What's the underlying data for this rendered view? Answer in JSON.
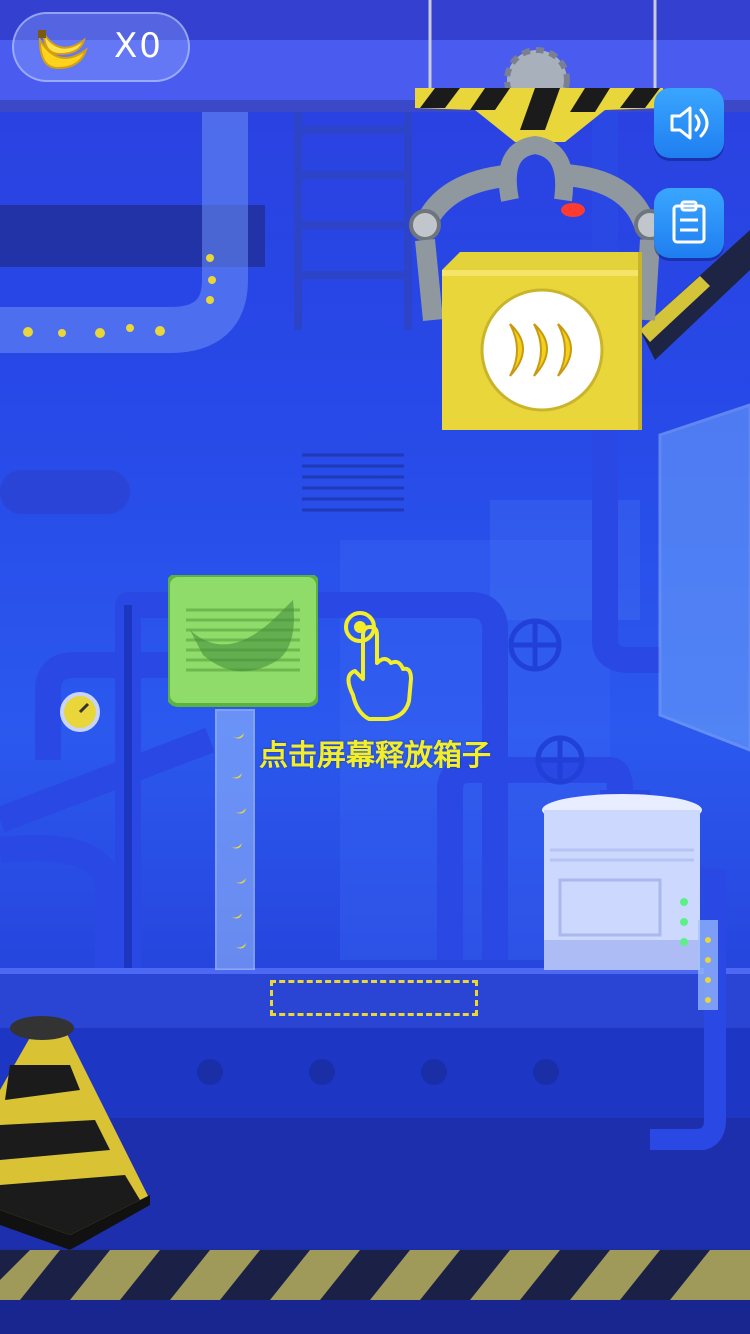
{
  "hud": {
    "banana_count": "X0",
    "banana_icon": "banana-bunch-icon",
    "sound_icon": "speaker-icon",
    "notes_icon": "clipboard-icon"
  },
  "instruction": {
    "text": "点击屏幕释放箱子"
  },
  "crate": {
    "icon": "three-bananas-icon"
  },
  "colors": {
    "background": "#2444e6",
    "accent_yellow": "#f2ef2a",
    "button_blue": "#2a8ff5",
    "crate_yellow": "#e8d63a",
    "hazard_black": "#1b1b1b"
  }
}
